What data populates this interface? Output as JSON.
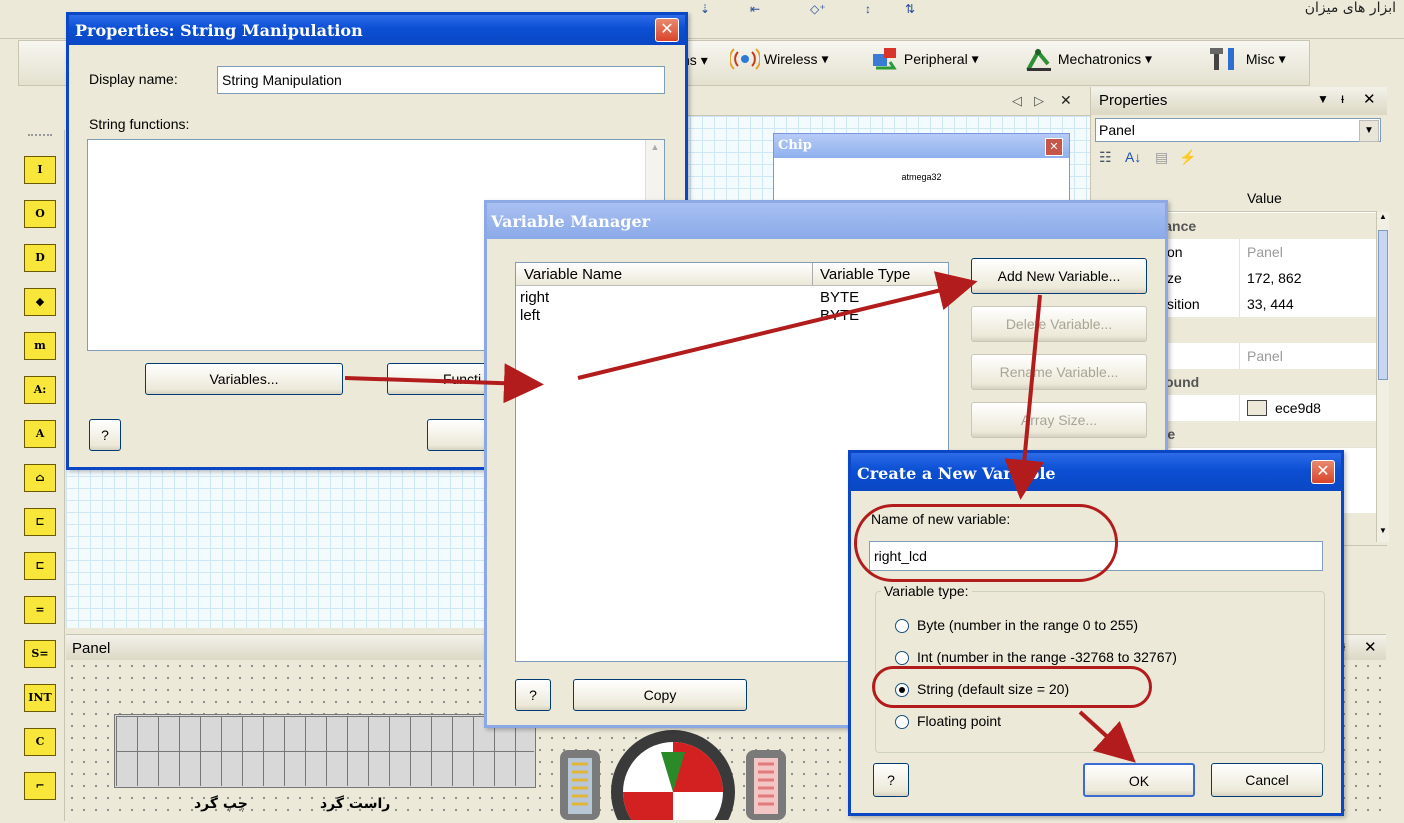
{
  "topbar": {
    "fragment": "ابزار های میزان"
  },
  "toolbar": {
    "menus": [
      {
        "label": "ns",
        "icon": "component-icon"
      },
      {
        "label": "Wireless",
        "icon": "wireless-icon"
      },
      {
        "label": "Peripheral",
        "icon": "peripheral-icon"
      },
      {
        "label": "Mechatronics",
        "icon": "mechatronics-icon"
      },
      {
        "label": "Misc",
        "icon": "misc-icon"
      }
    ],
    "dropdown_glyph": "▾"
  },
  "left_palette": {
    "items": [
      "I",
      "O",
      "D",
      "◆",
      "m",
      "A:",
      "A",
      "⌂",
      "⊏",
      "⊏",
      "=",
      "S=",
      "INT",
      "C",
      "⌐"
    ]
  },
  "properties_dialog": {
    "title": "Properties: String Manipulation",
    "display_name_label": "Display name:",
    "display_name_value": "String Manipulation",
    "string_functions_label": "String functions:",
    "variables_button": "Variables...",
    "functions_button": "Functi",
    "help_button": "?",
    "ok_button": "OK"
  },
  "chip_window": {
    "title": "Chip",
    "device": "atmega32"
  },
  "properties_panel": {
    "title": "Properties",
    "object": "Panel",
    "value_header": "Value",
    "rows": [
      {
        "name": "arance",
        "value": "",
        "category": true
      },
      {
        "name": "on",
        "value": "Panel",
        "category": false,
        "grey": true
      },
      {
        "name": "ze",
        "value": "172, 862",
        "category": false
      },
      {
        "name": "sition",
        "value": "33, 444",
        "category": false
      },
      {
        "name": "",
        "value": "",
        "category": true
      },
      {
        "name": "",
        "value": "Panel",
        "category": false,
        "grey": true
      },
      {
        "name": "ground",
        "value": "",
        "category": true
      },
      {
        "name": "",
        "value": "ece9d8",
        "category": false
      },
      {
        "name": "age",
        "value": "",
        "category": true
      }
    ]
  },
  "doc_tab_controls": {
    "prev": "◁",
    "next": "▷",
    "close": "✕"
  },
  "variable_manager": {
    "title": "Variable Manager",
    "columns": [
      "Variable Name",
      "Variable Type"
    ],
    "variables": [
      {
        "name": "right",
        "type": "BYTE"
      },
      {
        "name": "left",
        "type": "BYTE"
      }
    ],
    "buttons": {
      "add": "Add New Variable...",
      "delete": "Delete Variable...",
      "rename": "Rename Variable...",
      "array": "Array Size..."
    },
    "help_button": "?",
    "copy_button": "Copy"
  },
  "new_variable_dialog": {
    "title": "Create a New Variable",
    "name_label": "Name of new variable:",
    "name_value": "right_lcd",
    "type_group_label": "Variable type:",
    "options": [
      {
        "label": "Byte (number in the range 0 to 255)",
        "checked": false
      },
      {
        "label": "Int (number in the range -32768 to 32767)",
        "checked": false
      },
      {
        "label": "String (default size = 20)",
        "checked": true
      },
      {
        "label": "Floating point",
        "checked": false
      }
    ],
    "help_button": "?",
    "ok_button": "OK",
    "cancel_button": "Cancel"
  },
  "panel_window": {
    "title": "Panel",
    "label_right": "راست گرد",
    "label_left": "چپ گرد",
    "pin_glyph": "ᵻ",
    "close_glyph": "✕"
  },
  "annotation_color": "#b21c1c"
}
